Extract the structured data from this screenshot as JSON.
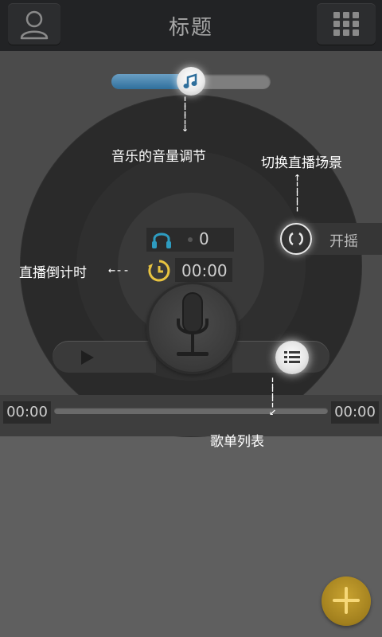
{
  "header": {
    "title": "标题"
  },
  "annotations": {
    "volume": "音乐的音量调节",
    "switch_scene": "切换直播场景",
    "countdown": "直播倒计时",
    "playlist": "歌单列表"
  },
  "listeners": {
    "count": "0"
  },
  "countdown": {
    "time": "00:00"
  },
  "switch": {
    "label": "开摇"
  },
  "progress": {
    "elapsed": "00:00",
    "total": "00:00",
    "fraction": 0
  },
  "volume": {
    "level_fraction": 0.5
  },
  "icons": {
    "user": "user-icon",
    "grid": "grid-menu-icon",
    "music": "music-note-icon",
    "headphone": "headphone-icon",
    "clock": "timer-icon",
    "switch": "switch-scene-icon",
    "play": "play-icon",
    "list": "list-icon",
    "mic": "microphone-icon",
    "add": "plus-icon"
  },
  "colors": {
    "accent_blue": "#2f6f9c",
    "add_button": "#a2801e",
    "clock_yellow": "#e8c340",
    "headphone_teal": "#2e9cc0"
  }
}
